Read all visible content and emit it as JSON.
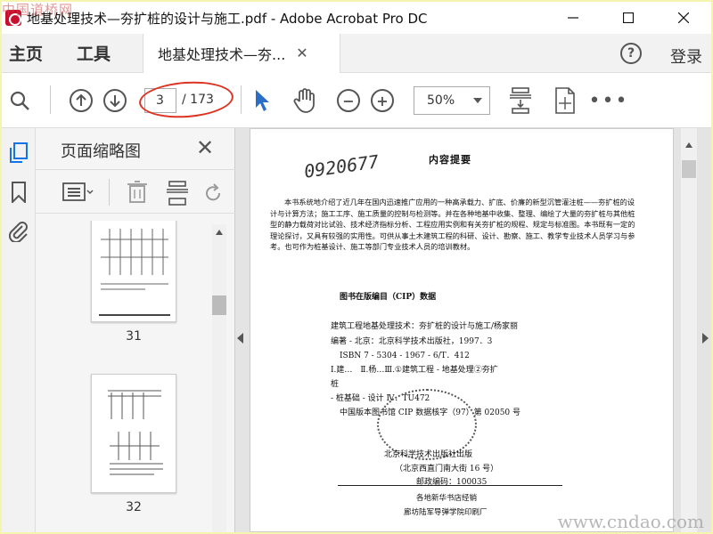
{
  "window": {
    "title": "地基处理技术—夯扩桩的设计与施工.pdf - Adobe Acrobat Pro DC"
  },
  "watermarks": {
    "top": "中国道桥网",
    "bottom": "www.cndao.com"
  },
  "tabbar": {
    "home": "主页",
    "tools": "工具",
    "doc_tab": "地基处理技术—夯...",
    "login": "登录"
  },
  "toolbar": {
    "page_current": "3",
    "page_total": "/ 173",
    "zoom": "50%"
  },
  "thumb_panel": {
    "title": "页面缩略图",
    "pages": [
      {
        "label": "31"
      },
      {
        "label": "32"
      }
    ]
  },
  "page": {
    "title": "内容提要",
    "handwriting": "0920677",
    "paragraph": "本书系统地介绍了近几年在国内迅速推广应用的一种高承载力、扩底、价廉的新型沉管灌注桩——夯扩桩的设计与计算方法；施工工序、施工质量的控制与检测等。并在各种地基中收集、整理、编绘了大量的夯扩桩与其他桩型的静力载荷对比试验、技术经济指标分析、工程应用实例和有关夯扩桩的规程、规定与标准图。本书既有一定的理论探讨，又具有较强的实用性。可供从事土木建筑工程的科研、设计、勘察、施工、教学专业技术人员学习与参考。也可作为桩基设计、施工等部门专业技术人员的培训教材。",
    "cip_head": "图书在版编目（CIP）数据",
    "cip_lines": [
      "建筑工程地基处理技术：夯扩桩的设计与施工/杨家丽",
      "编著 - 北京：北京科学技术出版社，1997．3",
      "ISBN 7 - 5304 - 1967 - 6/T．412",
      "Ⅰ.建…　Ⅱ.杨…Ⅲ.①建筑工程 - 地基处理②夯扩",
      "桩",
      "- 桩基础 - 设计 Ⅳ．TU472",
      "中国版本图书馆 CIP 数据核字（97）第 02050 号"
    ],
    "publisher": "北京科学技术出版社出版",
    "address": "（北京西直门南大街 16 号）",
    "postcode": "邮政编码：100035",
    "distributor": "各地新华书店经销",
    "printer": "廊坊陆军导弹学院印刷厂"
  }
}
